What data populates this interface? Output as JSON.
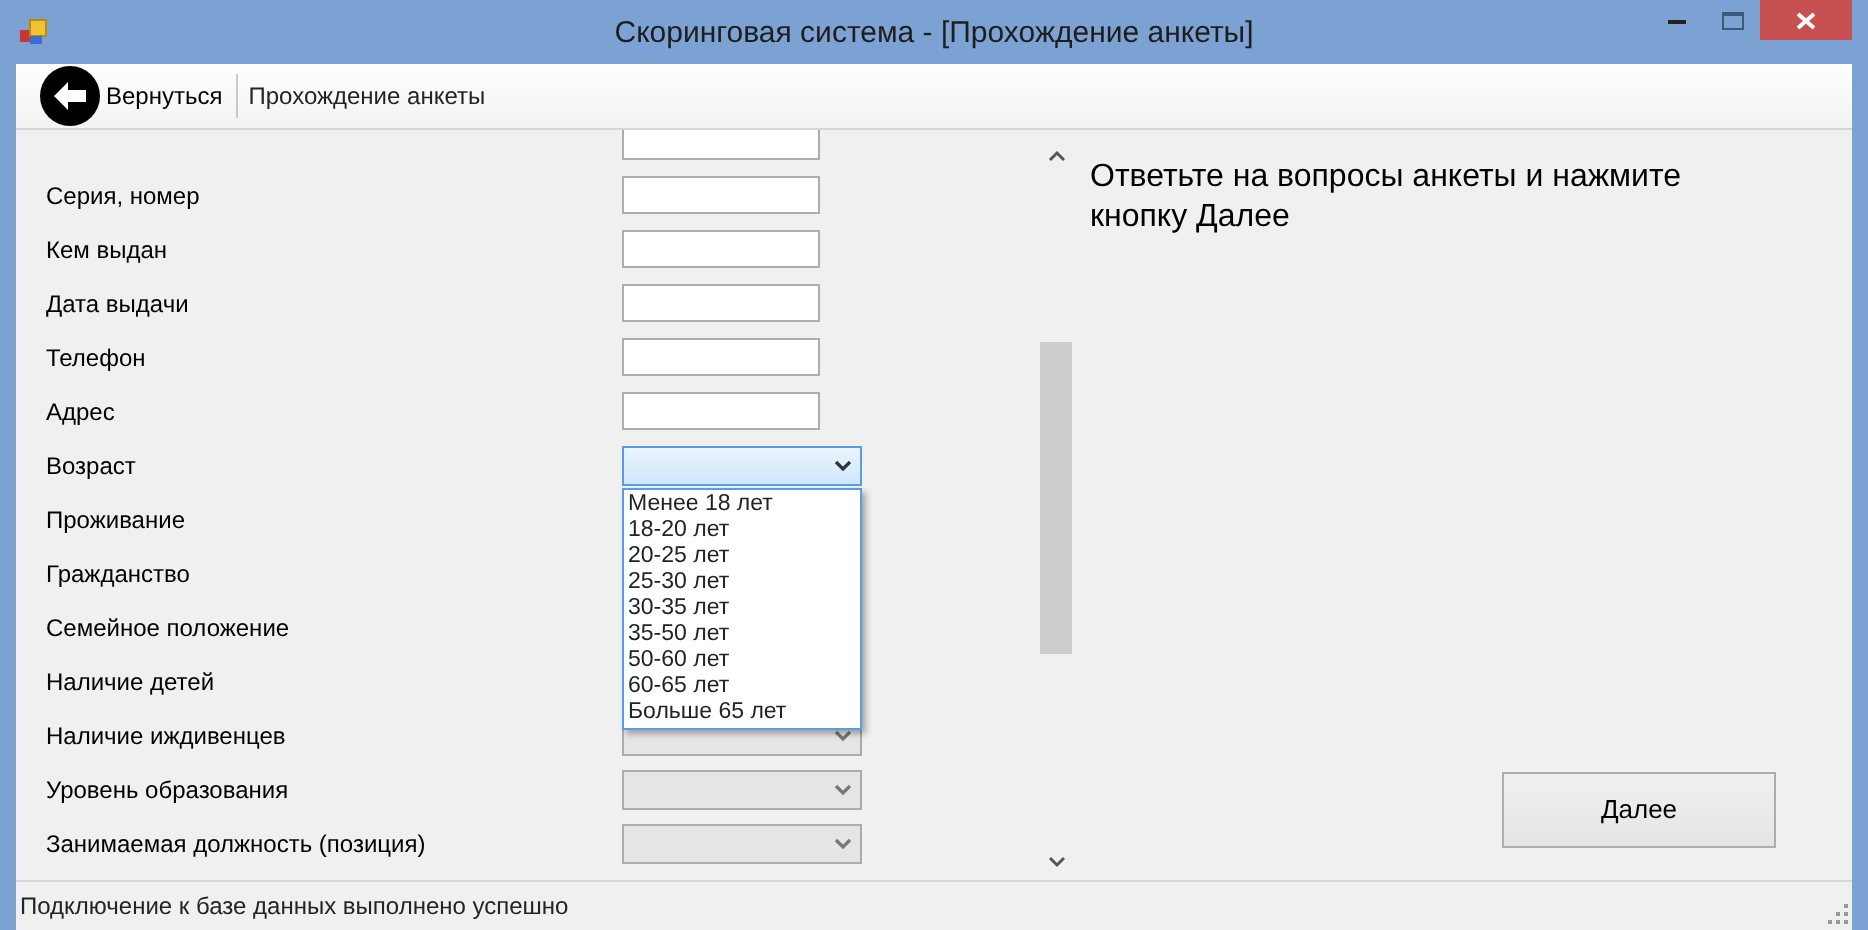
{
  "window": {
    "title": "Скоринговая система - [Прохождение анкеты]"
  },
  "toolbar": {
    "back_button": "Вернуться",
    "section_label": "Прохождение анкеты"
  },
  "form": {
    "rows": [
      {
        "kind": "textbox",
        "value": ""
      },
      {
        "kind": "textbox",
        "label": "Серия, номер",
        "value": ""
      },
      {
        "kind": "textbox",
        "label": "Кем выдан",
        "value": ""
      },
      {
        "kind": "textbox",
        "label": "Дата выдачи",
        "value": ""
      },
      {
        "kind": "textbox",
        "label": "Телефон",
        "value": ""
      },
      {
        "kind": "textbox",
        "label": "Адрес",
        "value": ""
      },
      {
        "kind": "combobox",
        "label": "Возраст",
        "expanded": true,
        "disabled": false
      },
      {
        "kind": "label",
        "label": "Проживание"
      },
      {
        "kind": "label",
        "label": "Гражданство"
      },
      {
        "kind": "label",
        "label": "Семейное положение"
      },
      {
        "kind": "label",
        "label": "Наличие детей"
      },
      {
        "kind": "combobox",
        "label": "Наличие иждивенцев",
        "expanded": false,
        "disabled": true
      },
      {
        "kind": "combobox",
        "label": "Уровень образования",
        "expanded": false,
        "disabled": true
      },
      {
        "kind": "combobox",
        "label": "Занимаемая должность (позиция)",
        "expanded": false,
        "disabled": true
      }
    ],
    "dropdown": {
      "items": [
        "Менее 18 лет",
        "18-20 лет",
        "20-25 лет",
        "25-30 лет",
        "30-35 лет",
        "35-50 лет",
        "50-60 лет",
        "60-65 лет",
        "Больше 65 лет"
      ]
    }
  },
  "info_panel": {
    "message": "Ответьте на вопросы анкеты и нажмите кнопку Далее",
    "next_button": "Далее"
  },
  "status_bar": "Подключение к базе данных выполнено успешно"
}
